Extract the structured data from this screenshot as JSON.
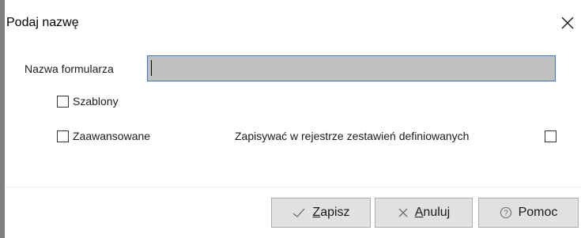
{
  "dialog": {
    "title": "Podaj nazwę",
    "close_icon": "close-icon"
  },
  "form": {
    "name_label": "Nazwa formularza",
    "name_value": "",
    "templates_label": "Szablony",
    "templates_checked": false,
    "advanced_label": "Zaawansowane",
    "advanced_checked": false,
    "registry_label": "Zapisywać w rejestrze zestawień definiowanych",
    "registry_checked": false
  },
  "buttons": {
    "save": {
      "mnemonic": "Z",
      "rest": "apisz",
      "icon": "check-icon"
    },
    "cancel": {
      "mnemonic": "A",
      "rest": "nuluj",
      "icon": "x-icon"
    },
    "help": {
      "label": "Pomoc",
      "icon": "help-circle-icon"
    }
  },
  "colors": {
    "input_background": "#c0c0c0",
    "input_border": "#3a78c4",
    "button_background": "#e1e1e1",
    "button_border": "#adadad"
  }
}
